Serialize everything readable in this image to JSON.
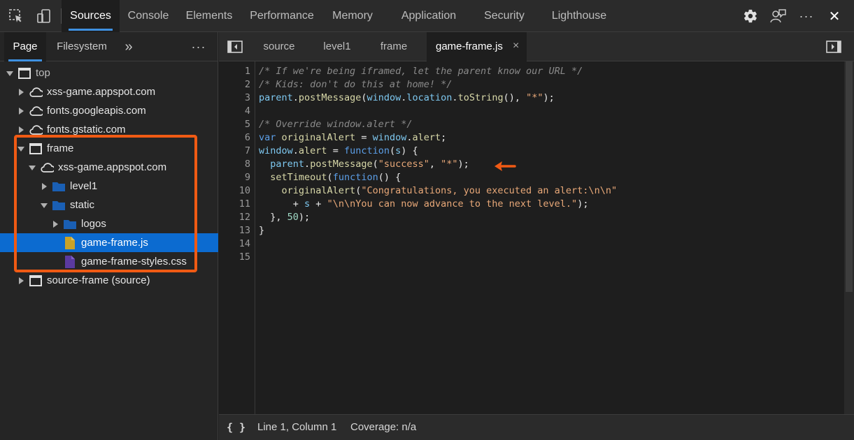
{
  "toolbar": {
    "tabs": [
      {
        "label": "Sources",
        "active": true
      },
      {
        "label": "Console"
      },
      {
        "label": "Elements"
      },
      {
        "label": "Performance"
      },
      {
        "label": "Memory"
      },
      {
        "label": "Application"
      },
      {
        "label": "Security"
      },
      {
        "label": "Lighthouse"
      }
    ],
    "icons": [
      "inspect-icon",
      "device-toggle-icon",
      "settings-gear-icon",
      "feedback-icon",
      "more-options-icon",
      "close-icon"
    ],
    "more_label": "···",
    "close_label": "✕"
  },
  "navigator": {
    "tabs": [
      {
        "label": "Page",
        "active": true
      },
      {
        "label": "Filesystem"
      }
    ],
    "overflow_label": "»",
    "more_label": "···",
    "tree": [
      {
        "label": "top",
        "icon": "frame-icon",
        "expanded": true
      },
      {
        "label": "xss-game.appspot.com",
        "icon": "cloud-icon",
        "expanded": false
      },
      {
        "label": "fonts.googleapis.com",
        "icon": "cloud-icon",
        "expanded": false
      },
      {
        "label": "fonts.gstatic.com",
        "icon": "cloud-icon",
        "expanded": false
      },
      {
        "label": "frame",
        "icon": "frame-icon",
        "expanded": true
      },
      {
        "label": "xss-game.appspot.com",
        "icon": "cloud-icon",
        "expanded": true
      },
      {
        "label": "level1",
        "icon": "folder-icon",
        "expanded": false
      },
      {
        "label": "static",
        "icon": "folder-icon",
        "expanded": true
      },
      {
        "label": "logos",
        "icon": "folder-icon",
        "expanded": false
      },
      {
        "label": "game-frame.js",
        "icon": "js-file-icon",
        "selected": true
      },
      {
        "label": "game-frame-styles.css",
        "icon": "css-file-icon"
      },
      {
        "label": "source-frame (source)",
        "icon": "frame-icon",
        "expanded": false
      }
    ]
  },
  "editor": {
    "tabs": [
      {
        "label": "source"
      },
      {
        "label": "level1"
      },
      {
        "label": "frame"
      },
      {
        "label": "game-frame.js",
        "active": true,
        "close": "×"
      }
    ],
    "line_numbers": [
      "1",
      "2",
      "3",
      "4",
      "5",
      "6",
      "7",
      "8",
      "9",
      "10",
      "11",
      "12",
      "13",
      "14",
      "15"
    ],
    "status": {
      "pretty_print": "{ }",
      "position": "Line 1, Column 1",
      "coverage": "Coverage: n/a"
    }
  },
  "colors": {
    "accent": "#3e90e0",
    "selection": "#0c6bd0",
    "annotation": "#f05a14"
  }
}
